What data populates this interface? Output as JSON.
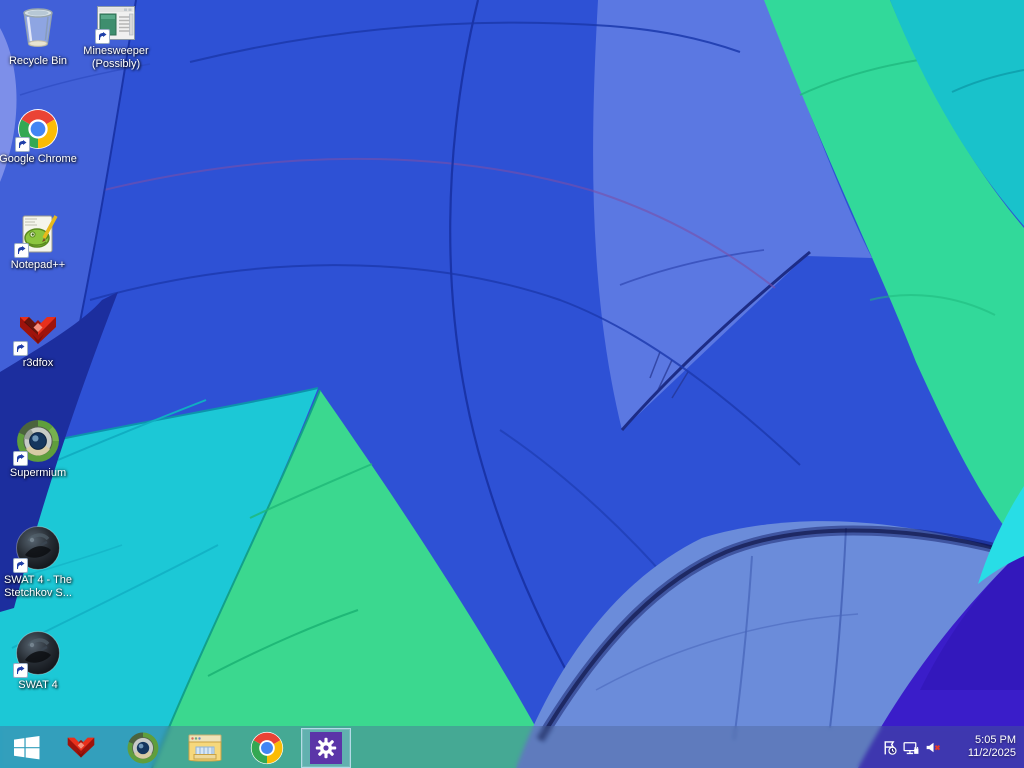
{
  "desktop": {
    "icons": [
      {
        "label": "Recycle Bin"
      },
      {
        "label": "Minesweeper (Possibly)"
      },
      {
        "label": "Google Chrome"
      },
      {
        "label": "Notepad++"
      },
      {
        "label": "r3dfox"
      },
      {
        "label": "Supermium"
      },
      {
        "label": "SWAT 4 - The Stetchkov S..."
      },
      {
        "label": "SWAT 4"
      }
    ]
  },
  "taskbar": {
    "buttons": [
      {
        "name": "start"
      },
      {
        "name": "r3dfox"
      },
      {
        "name": "supermium"
      },
      {
        "name": "file-explorer"
      },
      {
        "name": "google-chrome"
      },
      {
        "name": "settings",
        "active": true
      }
    ],
    "tray": {
      "icons": [
        {
          "name": "action-center"
        },
        {
          "name": "network"
        },
        {
          "name": "volume-muted"
        }
      ],
      "time": "5:05 PM",
      "date": "11/2/2025"
    }
  },
  "colors": {
    "balloon_royal_blue": "#2E51D5",
    "balloon_light_blue": "#5B78E2",
    "balloon_cyan": "#1CC8D6",
    "balloon_green": "#3BD88F",
    "balloon_teal": "#19C2CB",
    "balloon_cornflower": "#6B8CDA",
    "balloon_indigo": "#3A1DC9",
    "settings_tile_purple": "#5B35A8"
  }
}
